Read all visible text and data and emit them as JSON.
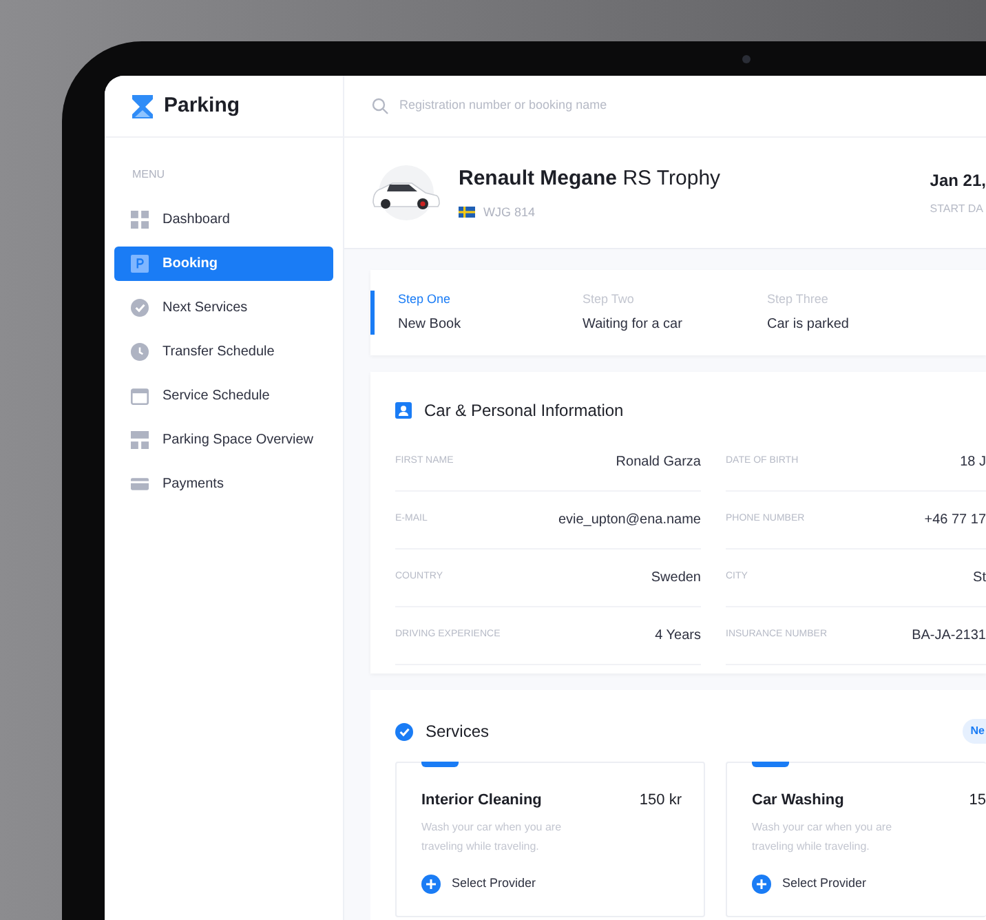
{
  "app": {
    "title": "Parking"
  },
  "search": {
    "placeholder": "Registration number or booking name"
  },
  "sidebar": {
    "heading": "MENU",
    "items": [
      {
        "label": "Dashboard",
        "selected": false
      },
      {
        "label": "Booking",
        "selected": true
      },
      {
        "label": "Next Services",
        "selected": false
      },
      {
        "label": "Transfer Schedule",
        "selected": false
      },
      {
        "label": "Service Schedule",
        "selected": false
      },
      {
        "label": "Parking Space Overview",
        "selected": false
      },
      {
        "label": "Payments",
        "selected": false
      }
    ]
  },
  "vehicle": {
    "name": "**Renault Megane** RS Trophy",
    "plate": "WJG 814",
    "date": "Jan 21,",
    "date_label": "START DA"
  },
  "steps": [
    {
      "step": "Step One",
      "title": "New Book",
      "selected": true
    },
    {
      "step": "Step Two",
      "title": "Waiting for a car",
      "selected": false
    },
    {
      "step": "Step Three",
      "title": "Car is parked",
      "selected": false
    }
  ],
  "info": {
    "title": "Car & Personal Information",
    "fields": [
      {
        "label": "FIRST NAME",
        "value": "Ronald Garza"
      },
      {
        "label": "DATE OF BIRTH",
        "value": "18 J"
      },
      {
        "label": "E-MAIL",
        "value": "evie_upton@ena.name"
      },
      {
        "label": "PHONE NUMBER",
        "value": "+46 77 17"
      },
      {
        "label": "COUNTRY",
        "value": "Sweden"
      },
      {
        "label": "CITY",
        "value": "St"
      },
      {
        "label": "DRIVING EXPERIENCE",
        "value": "4 Years"
      },
      {
        "label": "INSURANCE NUMBER",
        "value": "BA-JA-2131"
      }
    ]
  },
  "services": {
    "title": "Services",
    "badge": "Ne",
    "items": [
      {
        "name": "Interior Cleaning",
        "price": "150 kr",
        "description": "Wash your car when you are traveling while traveling.",
        "action": "Select Provider"
      },
      {
        "name": "Car Washing",
        "price": "15",
        "description": "Wash your car when you are traveling while traveling.",
        "action": "Select Provider"
      }
    ]
  }
}
